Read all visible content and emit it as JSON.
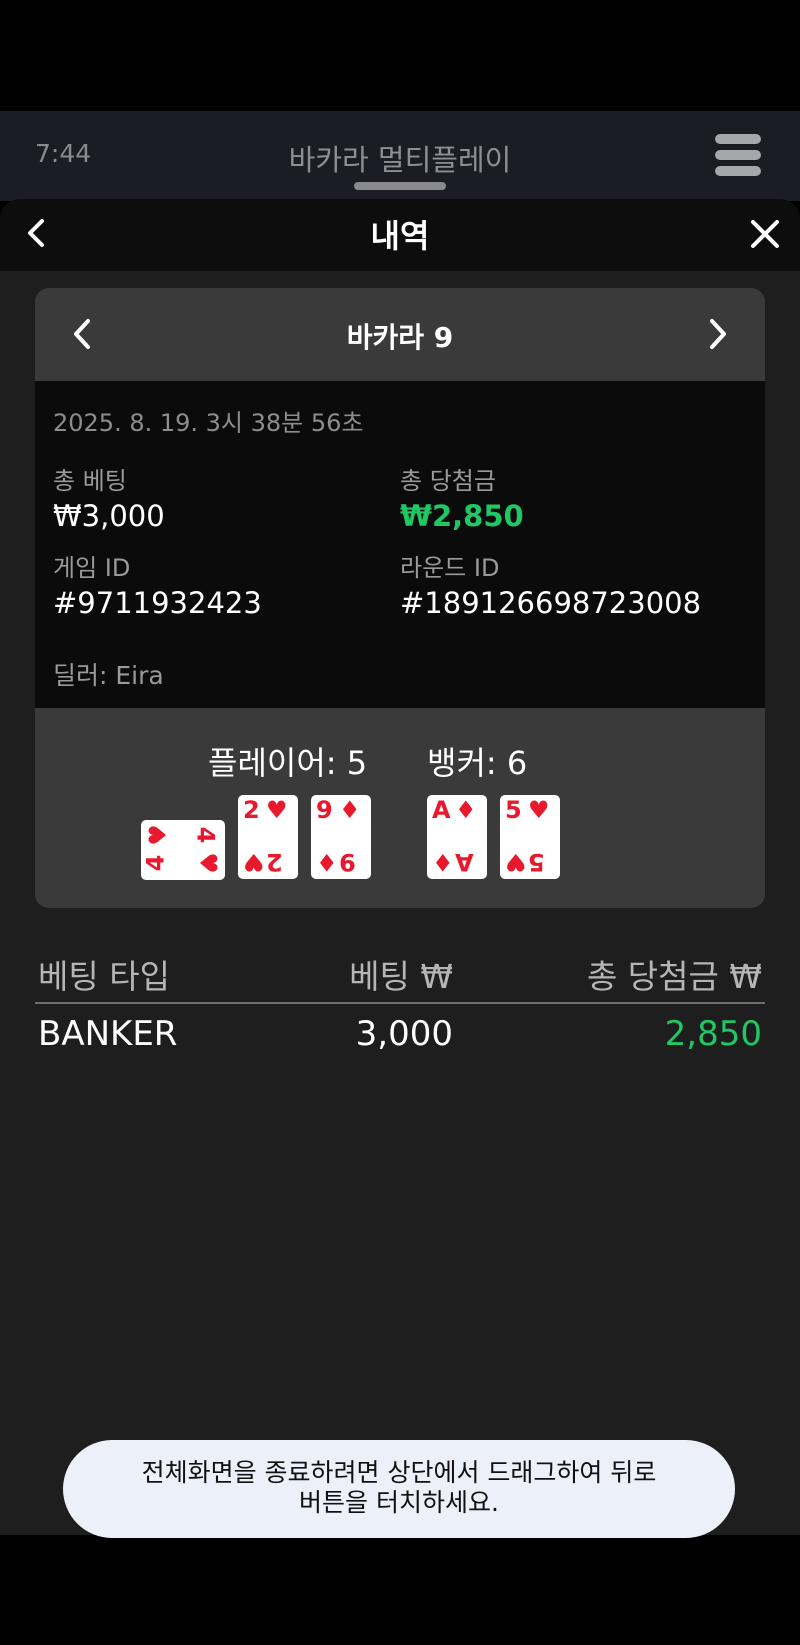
{
  "status_bar": {
    "time": "7:44",
    "title": "바카라 멀티플레이"
  },
  "sheet": {
    "title": "내역"
  },
  "card": {
    "game_name": "바카라 9",
    "date": "2025. 8. 19. 3시 38분 56초",
    "total_bet_label": "총 베팅",
    "total_bet_value": "₩3,000",
    "total_win_label": "총 당첨금",
    "total_win_value": "₩2,850",
    "game_id_label": "게임 ID",
    "game_id_value": "#9711932423",
    "round_id_label": "라운드 ID",
    "round_id_value": "#189126698723008",
    "dealer": "딜러: Eira"
  },
  "hands": {
    "player_score": "플레이어: 5",
    "banker_score": "뱅커: 6",
    "player_cards": [
      {
        "rank": "4",
        "suit": "♥"
      },
      {
        "rank": "2",
        "suit": "♥"
      },
      {
        "rank": "9",
        "suit": "♦"
      }
    ],
    "banker_cards": [
      {
        "rank": "A",
        "suit": "♦"
      },
      {
        "rank": "5",
        "suit": "♥"
      }
    ]
  },
  "bets_table": {
    "headers": [
      "베팅 타입",
      "베팅 ₩",
      "총 당첨금 ₩"
    ],
    "rows": [
      {
        "type": "BANKER",
        "bet": "3,000",
        "win": "2,850"
      }
    ]
  },
  "colors": {
    "win_green": "#1fc865",
    "card_red": "#e8192c"
  },
  "toast": {
    "line1": "전체화면을 종료하려면 상단에서 드래그하여 뒤로",
    "line2": "버튼을 터치하세요."
  }
}
